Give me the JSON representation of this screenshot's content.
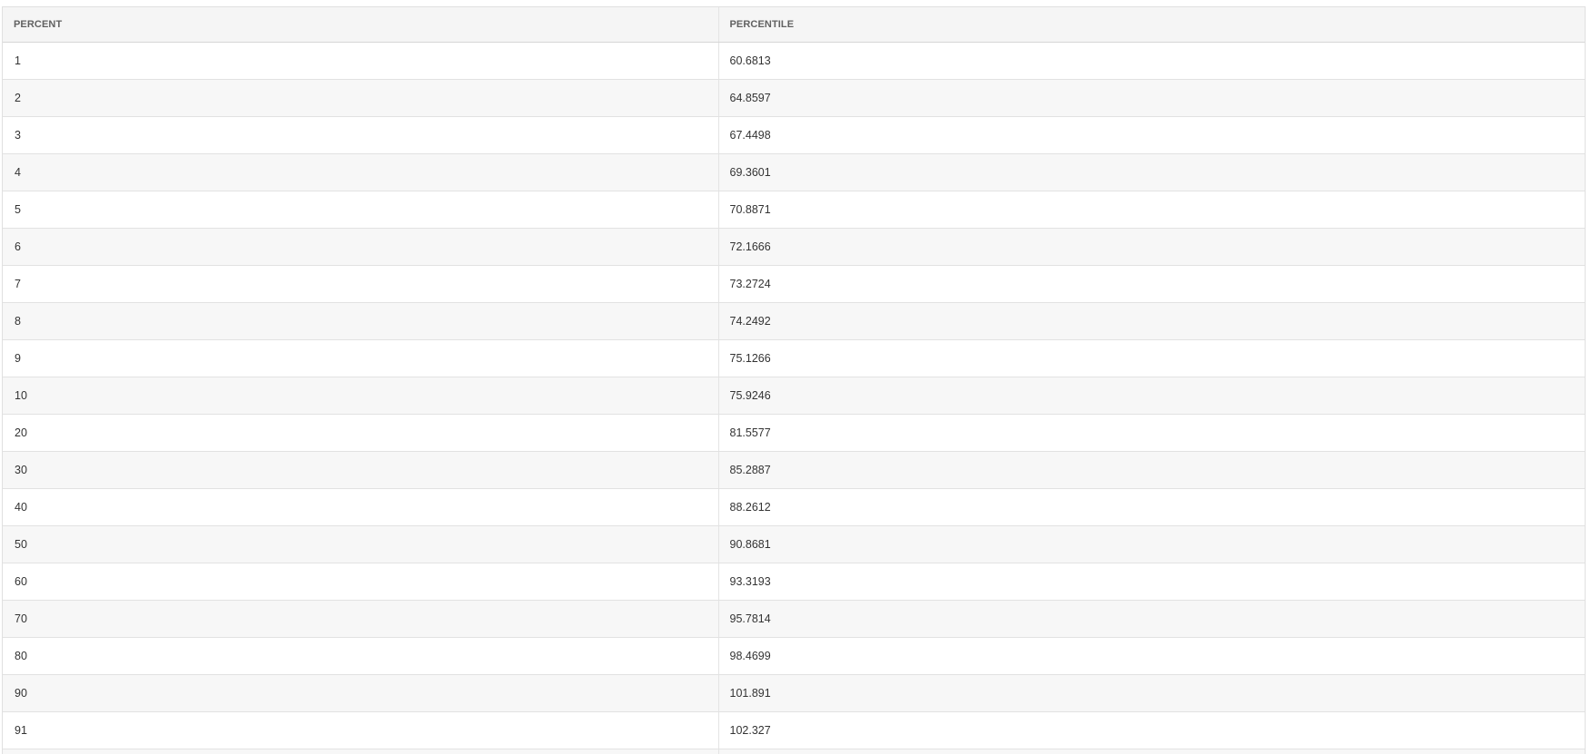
{
  "table": {
    "columns": [
      "PERCENT",
      "PERCENTILE"
    ],
    "rows": [
      [
        "1",
        "60.6813"
      ],
      [
        "2",
        "64.8597"
      ],
      [
        "3",
        "67.4498"
      ],
      [
        "4",
        "69.3601"
      ],
      [
        "5",
        "70.8871"
      ],
      [
        "6",
        "72.1666"
      ],
      [
        "7",
        "73.2724"
      ],
      [
        "8",
        "74.2492"
      ],
      [
        "9",
        "75.1266"
      ],
      [
        "10",
        "75.9246"
      ],
      [
        "20",
        "81.5577"
      ],
      [
        "30",
        "85.2887"
      ],
      [
        "40",
        "88.2612"
      ],
      [
        "50",
        "90.8681"
      ],
      [
        "60",
        "93.3193"
      ],
      [
        "70",
        "95.7814"
      ],
      [
        "80",
        "98.4699"
      ],
      [
        "90",
        "101.891"
      ],
      [
        "91",
        "102.327"
      ],
      [
        "",
        ""
      ]
    ]
  }
}
